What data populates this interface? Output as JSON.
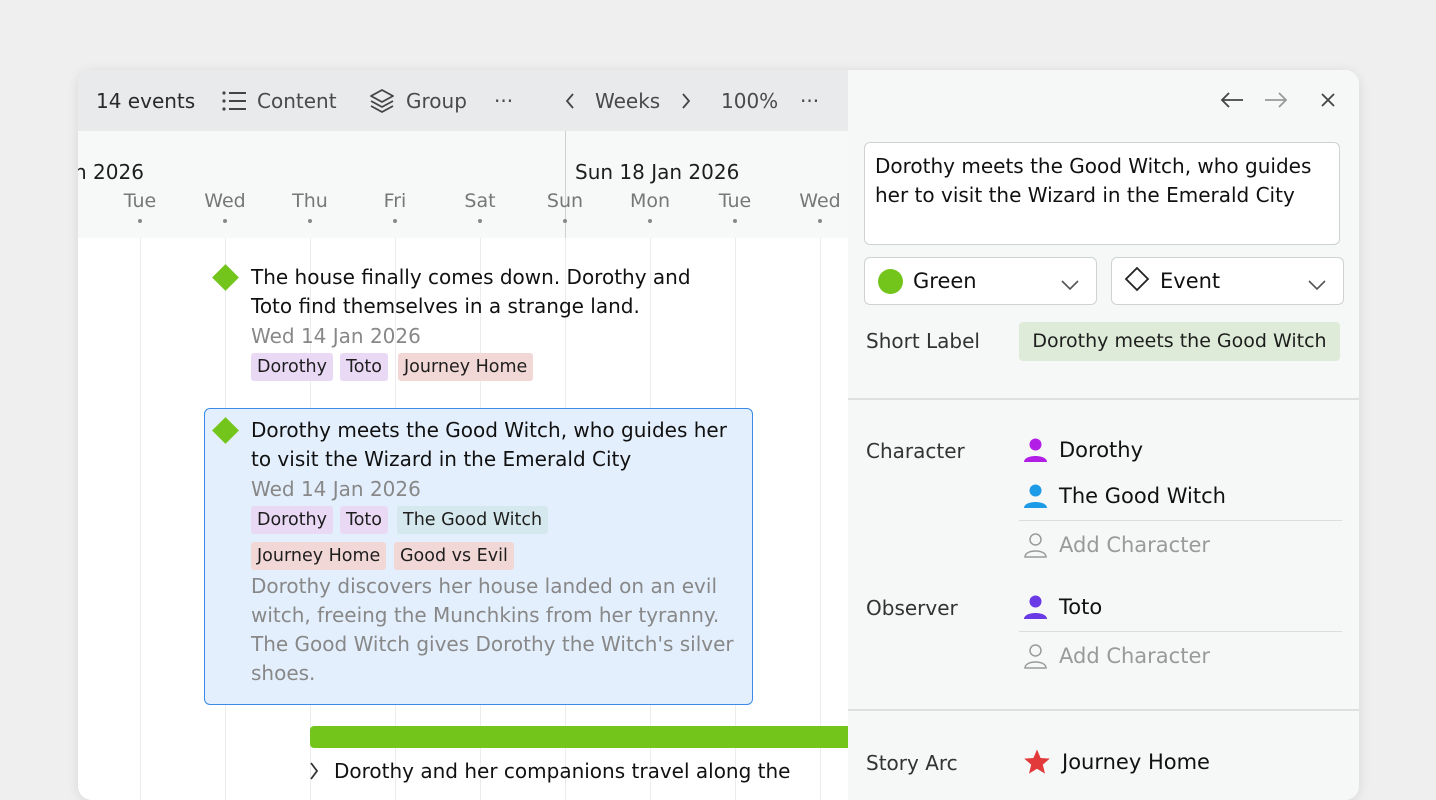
{
  "colors": {
    "accent_green": "#73c51c",
    "selection_blue": "#3b8ae6",
    "character_purple": "#b31ee6",
    "character_blue": "#1e9be6",
    "observer_purple": "#6a3ae6",
    "arc_red": "#e23a3a"
  },
  "toolbar": {
    "events_count": "14 events",
    "content_label": "Content",
    "content_icon": "list-icon",
    "group_label": "Group",
    "group_icon": "layers-icon",
    "more_label": "···",
    "prev_icon": "chevron-left-icon",
    "scale_label": "Weeks",
    "next_icon": "chevron-right-icon",
    "zoom_label": "100%",
    "more2_label": "···"
  },
  "timeline": {
    "week1_label": "n 2026",
    "week2_label": "Sun 18 Jan 2026",
    "days": [
      "Tue",
      "Wed",
      "Thu",
      "Fri",
      "Sat",
      "Sun",
      "Mon",
      "Tue",
      "Wed"
    ]
  },
  "events": [
    {
      "title_line1": "The house finally comes down. Dorothy and",
      "title_line2": "Toto find themselves in a strange land.",
      "date": "Wed 14 Jan 2026",
      "tags": [
        "Dorothy",
        "Toto",
        "Journey Home"
      ]
    },
    {
      "title_line1": "Dorothy meets the Good Witch, who guides her",
      "title_line2": "to visit the Wizard in the Emerald City",
      "date": "Wed 14 Jan 2026",
      "tags": [
        "Dorothy",
        "Toto",
        "The Good Witch",
        "Journey Home",
        "Good vs Evil"
      ],
      "description_lines": [
        "Dorothy discovers her house landed on an evil",
        "witch, freeing the Munchkins from her tyranny.",
        "The Good Witch gives Dorothy the Witch's silver",
        "shoes."
      ]
    },
    {
      "title": "Dorothy and her companions travel along the"
    }
  ],
  "panel": {
    "back_icon": "arrow-left-icon",
    "forward_icon": "arrow-right-icon",
    "close_icon": "close-icon",
    "title_line1": "Dorothy  meets the Good Witch, who guides",
    "title_line2": "her to visit the Wizard in the Emerald City",
    "color_select": "Green",
    "type_select": "Event",
    "short_label_label": "Short Label",
    "short_label_value": "Dorothy  meets the Good Witch",
    "character_label": "Character",
    "characters": [
      "Dorothy",
      "The Good Witch"
    ],
    "add_character": "Add Character",
    "observer_label": "Observer",
    "observers": [
      "Toto"
    ],
    "add_observer": "Add Character",
    "story_arc_label": "Story Arc",
    "story_arc": "Journey Home"
  }
}
